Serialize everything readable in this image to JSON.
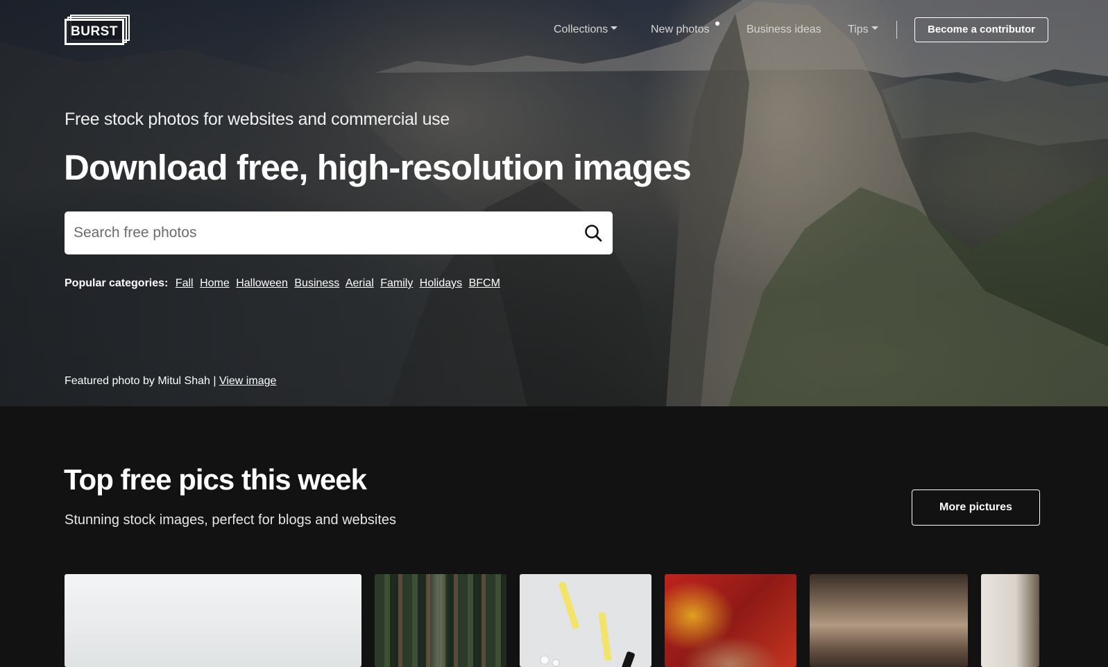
{
  "header": {
    "logo_text": "BURST",
    "nav": [
      {
        "label": "Collections",
        "has_dropdown": true
      },
      {
        "label": "New photos",
        "has_indicator_dot": true
      },
      {
        "label": "Business ideas"
      },
      {
        "label": "Tips",
        "has_dropdown": true
      }
    ],
    "cta_label": "Become a contributor"
  },
  "hero": {
    "subtitle": "Free stock photos for websites and commercial use",
    "headline": "Download free, high-resolution images",
    "search": {
      "placeholder": "Search free photos",
      "value": "",
      "icon": "search-icon"
    },
    "popular_label": "Popular categories:",
    "categories": [
      "Fall",
      "Home",
      "Halloween",
      "Business",
      "Aerial",
      "Family",
      "Holidays",
      "BFCM"
    ],
    "credit_text": "Featured photo by Mitul Shah |",
    "credit_link": "View image"
  },
  "top_pics": {
    "title": "Top free pics this week",
    "subtitle": "Stunning stock images, perfect for blogs and websites",
    "more_label": "More pictures"
  },
  "colors": {
    "page_background": "#121212",
    "text": "#ffffff",
    "nav_text": "#d6d6d6"
  }
}
